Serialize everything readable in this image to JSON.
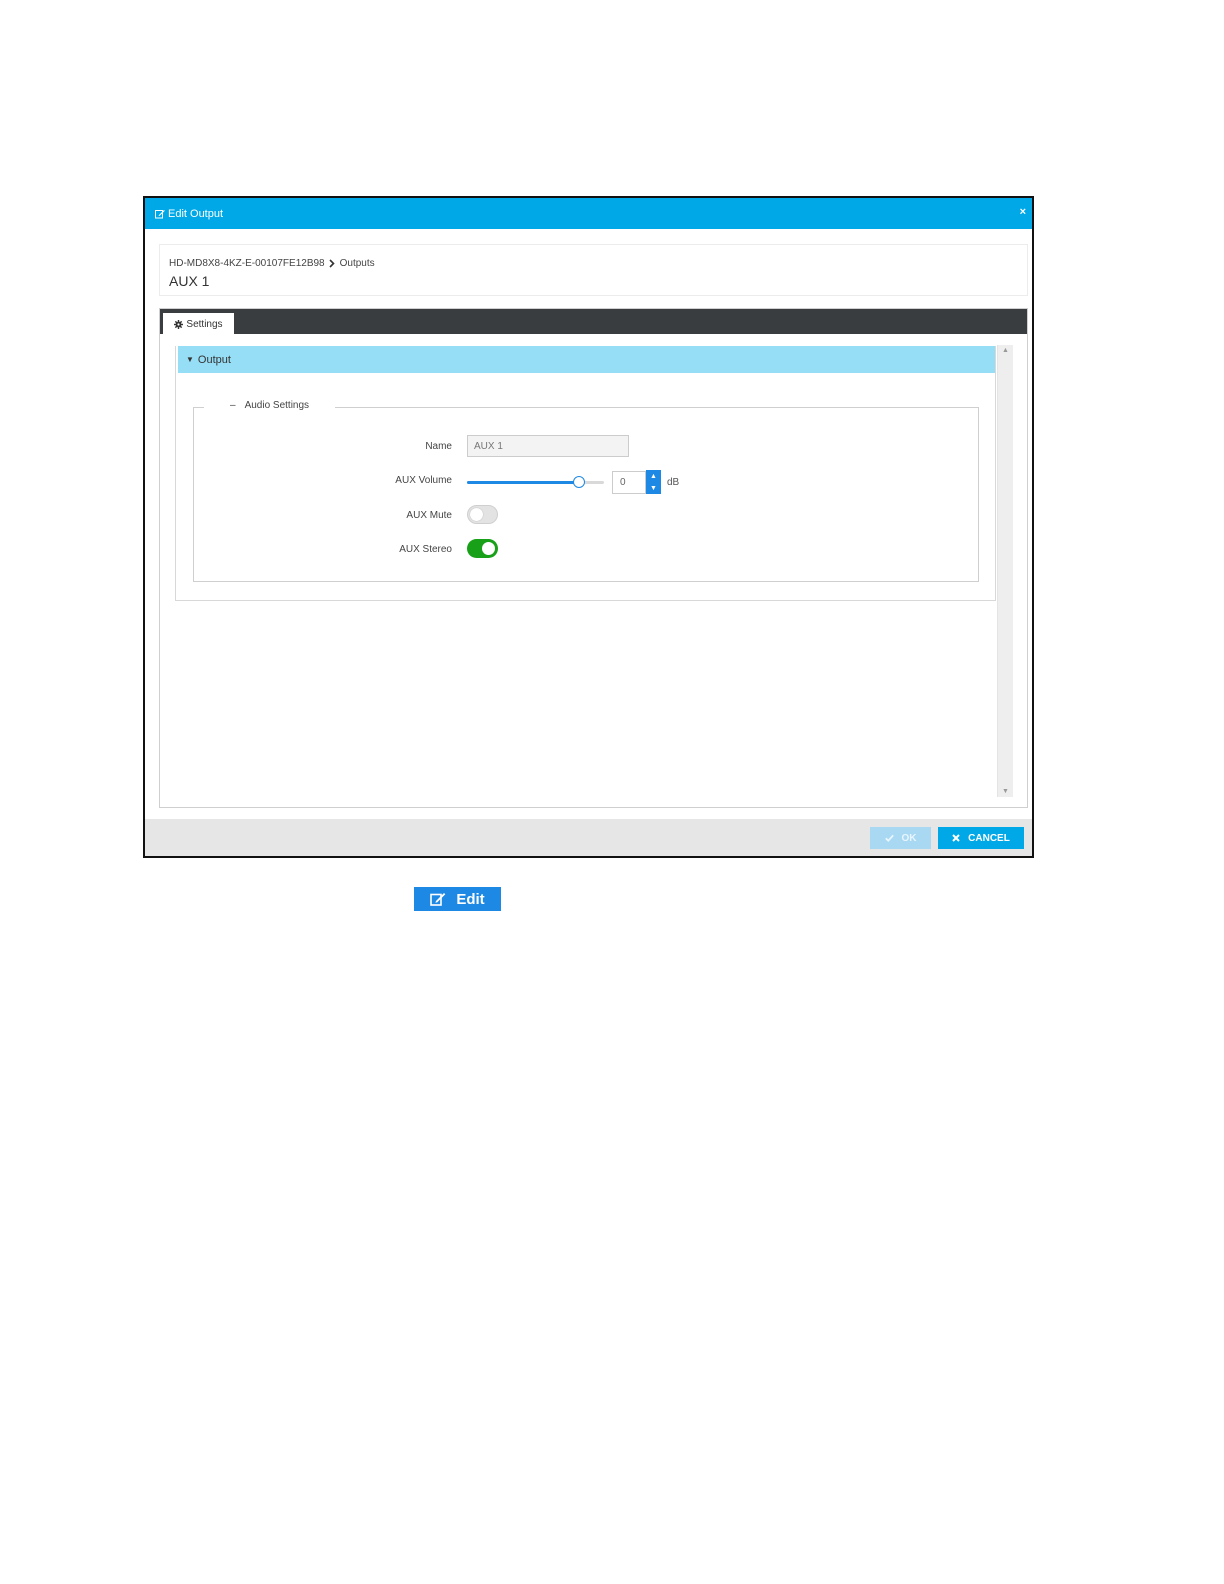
{
  "dialog": {
    "title": "Edit Output",
    "close_label": "×",
    "breadcrumb": {
      "device": "HD-MD8X8-4KZ-E-00107FE12B98",
      "section": "Outputs"
    },
    "page_title": "AUX 1",
    "tabs": [
      {
        "label": "Settings"
      }
    ],
    "section": {
      "title": "Output"
    },
    "fieldset": {
      "legend": "Audio Settings",
      "toggle_symbol": "–"
    },
    "fields": {
      "name": {
        "label": "Name",
        "value": "AUX 1"
      },
      "volume": {
        "label": "AUX Volume",
        "value": "0",
        "unit": "dB",
        "slider_fraction": 0.82
      },
      "mute": {
        "label": "AUX Mute",
        "on": false
      },
      "stereo": {
        "label": "AUX Stereo",
        "on": true
      }
    },
    "buttons": {
      "ok": "OK",
      "cancel": "CANCEL"
    }
  },
  "edit_button": {
    "label": "Edit"
  },
  "colors": {
    "accent": "#00a8e8",
    "section_header": "#96def5",
    "toggle_on": "#18a018",
    "button_blue": "#1e88e5"
  },
  "icons": {
    "title": "edit-icon",
    "tab": "gear-icon",
    "ok": "check-icon",
    "cancel": "close-icon",
    "edit_button": "edit-icon"
  }
}
